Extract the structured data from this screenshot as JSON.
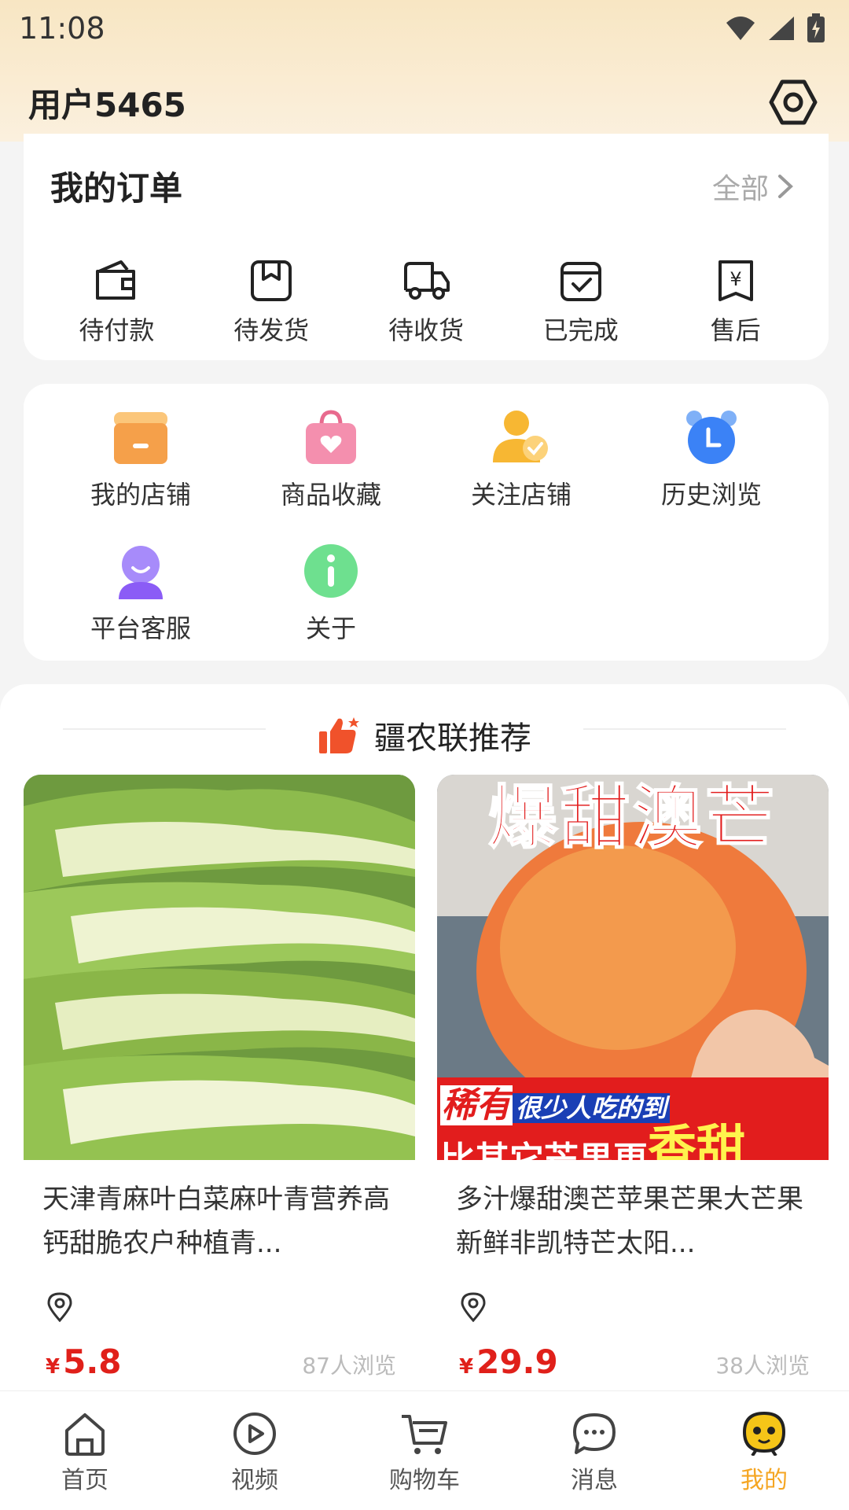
{
  "status_bar": {
    "time": "11:08"
  },
  "header": {
    "username": "用户5465"
  },
  "orders": {
    "title": "我的订单",
    "all_label": "全部",
    "items": [
      {
        "label": "待付款",
        "icon": "wallet-icon"
      },
      {
        "label": "待发货",
        "icon": "package-icon"
      },
      {
        "label": "待收货",
        "icon": "truck-icon"
      },
      {
        "label": "已完成",
        "icon": "completed-icon"
      },
      {
        "label": "售后",
        "icon": "after-sales-icon"
      }
    ]
  },
  "tools": [
    {
      "label": "我的店铺",
      "icon": "store-icon",
      "color": "#f5a04a"
    },
    {
      "label": "商品收藏",
      "icon": "bag-heart-icon",
      "color": "#f07fa0"
    },
    {
      "label": "关注店铺",
      "icon": "followed-user-icon",
      "color": "#f7b733"
    },
    {
      "label": "历史浏览",
      "icon": "clock-icon",
      "color": "#3b82f6"
    },
    {
      "label": "平台客服",
      "icon": "customer-service-icon",
      "color": "#8b5cf6"
    },
    {
      "label": "关于",
      "icon": "info-icon",
      "color": "#4ade80"
    }
  ],
  "recommend": {
    "title": "疆农联推荐",
    "products": [
      {
        "name": "天津青麻叶白菜麻叶青营养高钙甜脆农户种植青...",
        "currency": "¥",
        "price": "5.8",
        "views": "87人浏览"
      },
      {
        "name": "多汁爆甜澳芒苹果芒果大芒果新鲜非凯特芒太阳...",
        "currency": "¥",
        "price": "29.9",
        "views": "38人浏览",
        "image_text": {
          "headline": "爆甜澳芒",
          "line1_a": "稀有",
          "line1_b": "很少人吃的到",
          "line2_a": "比其它芒果更",
          "line2_b": "香甜"
        }
      }
    ]
  },
  "tabbar": {
    "items": [
      {
        "label": "首页",
        "icon": "home-icon"
      },
      {
        "label": "视频",
        "icon": "video-icon"
      },
      {
        "label": "购物车",
        "icon": "cart-icon"
      },
      {
        "label": "消息",
        "icon": "message-icon"
      },
      {
        "label": "我的",
        "icon": "profile-icon",
        "active": true
      }
    ],
    "active_color": "#f5a623"
  },
  "colors": {
    "accent": "#f5a623",
    "price": "#e0201a",
    "top_gradient": "#f8e6c3"
  }
}
